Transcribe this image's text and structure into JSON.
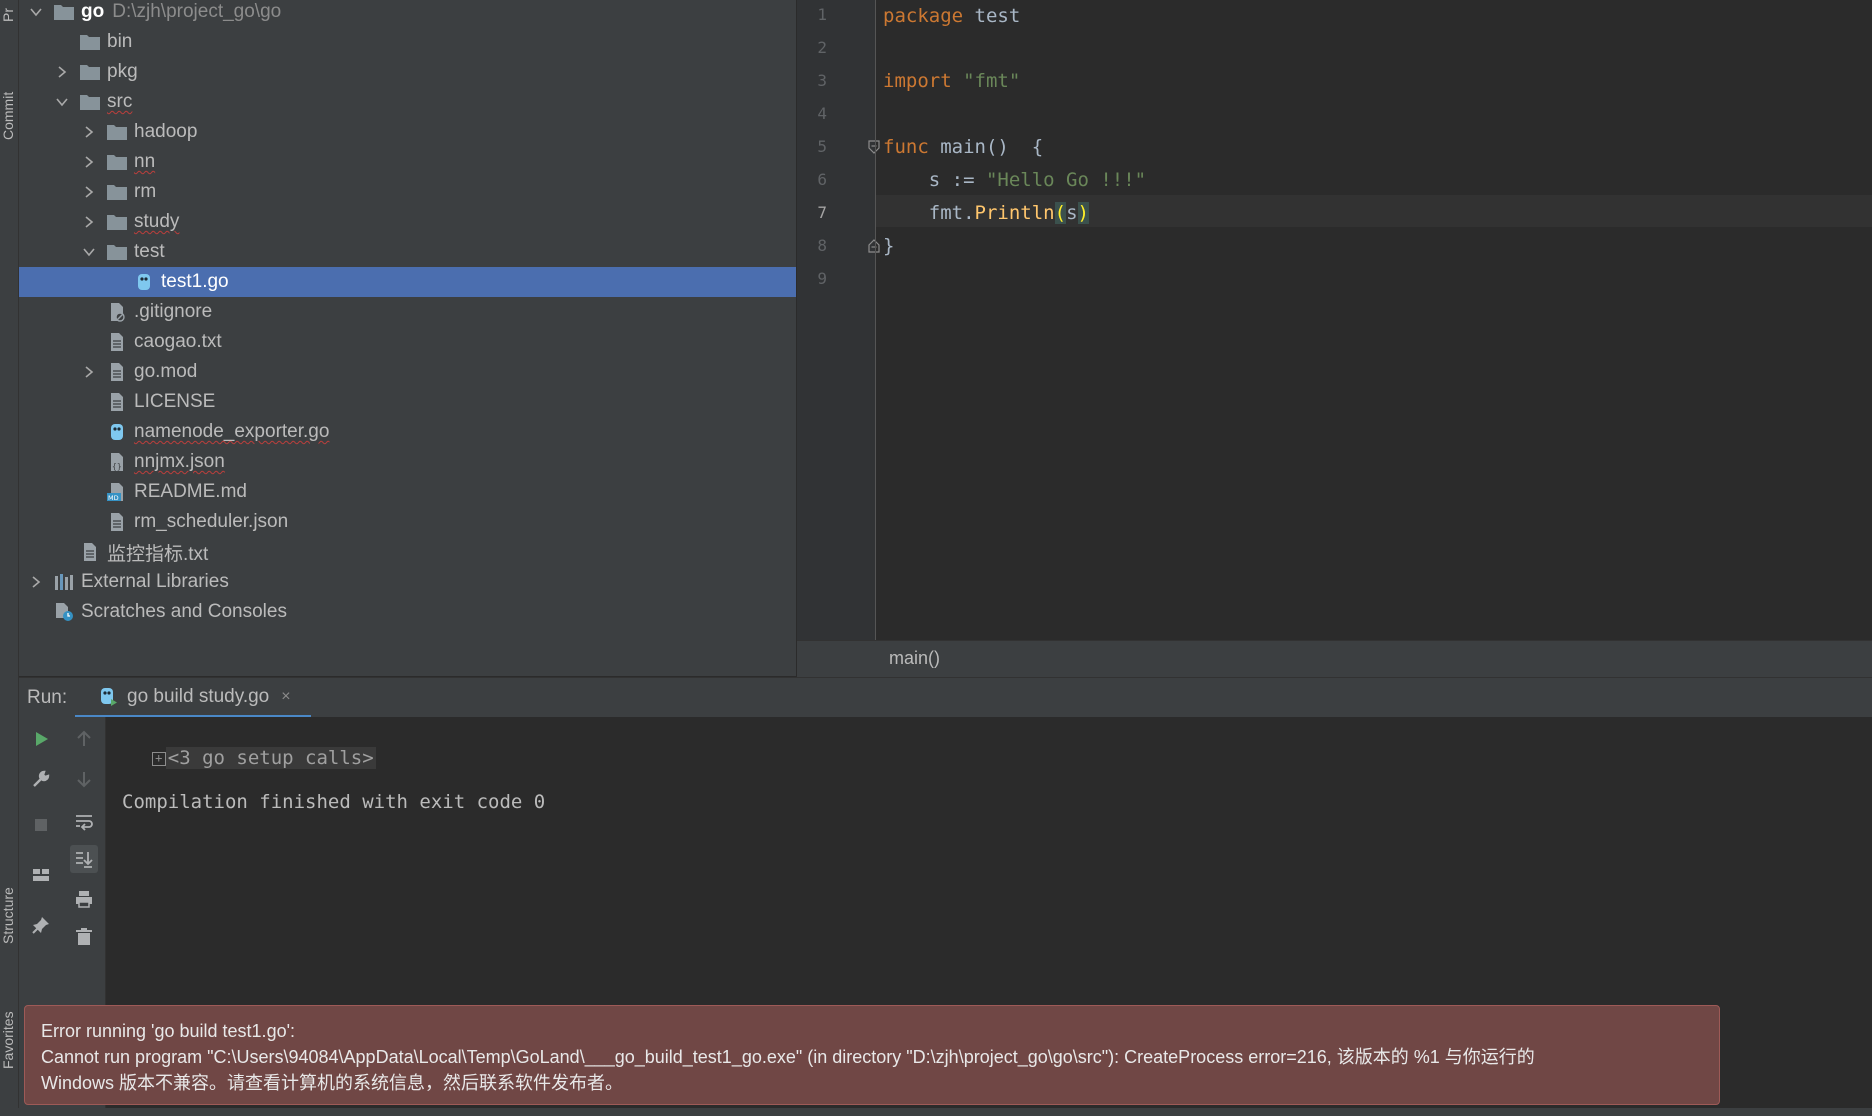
{
  "sidebar": {
    "top_label": "Pr",
    "commit_label": "Commit",
    "structure_label": "Structure",
    "favorites_label": "Favorites"
  },
  "project_tree": {
    "root_name": "go",
    "root_path": "D:\\zjh\\project_go\\go",
    "items": [
      {
        "label": "bin",
        "icon": "folder-icon"
      },
      {
        "label": "pkg",
        "icon": "folder-icon"
      },
      {
        "label": "src",
        "icon": "folder-icon"
      },
      {
        "label": "hadoop",
        "icon": "folder-icon"
      },
      {
        "label": "nn",
        "icon": "folder-icon"
      },
      {
        "label": "rm",
        "icon": "folder-icon"
      },
      {
        "label": "study",
        "icon": "folder-icon"
      },
      {
        "label": "test",
        "icon": "folder-icon"
      },
      {
        "label": "test1.go",
        "icon": "go-file-icon"
      },
      {
        "label": ".gitignore",
        "icon": "ignore-file-icon"
      },
      {
        "label": "caogao.txt",
        "icon": "text-file-icon"
      },
      {
        "label": "go.mod",
        "icon": "text-file-icon"
      },
      {
        "label": "LICENSE",
        "icon": "text-file-icon"
      },
      {
        "label": "namenode_exporter.go",
        "icon": "go-file-icon"
      },
      {
        "label": "nnjmx.json",
        "icon": "json-file-icon"
      },
      {
        "label": "README.md",
        "icon": "markdown-file-icon"
      },
      {
        "label": "rm_scheduler.json",
        "icon": "text-file-icon"
      },
      {
        "label": "监控指标.txt",
        "icon": "text-file-icon"
      },
      {
        "label": "External Libraries",
        "icon": "libraries-icon"
      },
      {
        "label": "Scratches and Consoles",
        "icon": "scratches-icon"
      }
    ]
  },
  "editor": {
    "line_numbers": [
      "1",
      "2",
      "3",
      "4",
      "5",
      "6",
      "7",
      "8",
      "9"
    ],
    "code": {
      "l1_kw": "package",
      "l1_rest": " test",
      "l3_kw": "import",
      "l3_sp": " ",
      "l3_str": "\"fmt\"",
      "l5_kw": "func",
      "l5_sp": " ",
      "l5_fn": "main",
      "l5_rest": "()  {",
      "l6_pre": "    s := ",
      "l6_str": "\"Hello Go !!!\"",
      "l7_pre": "    ",
      "l7_pkg": "fmt.",
      "l7_fn": "Println",
      "l7_open": "(",
      "l7_arg": "s",
      "l7_close": ")",
      "l8": "}"
    },
    "breadcrumb": "main()"
  },
  "run_panel": {
    "label": "Run:",
    "tab_label": "go build study.go",
    "tab_close": "×",
    "console_lines": {
      "folded": "<3 go setup calls>",
      "finished": "Compilation finished with exit code 0"
    }
  },
  "error_balloon": {
    "line1": "Error running 'go build test1.go':",
    "line2": "Cannot run program \"C:\\Users\\94084\\AppData\\Local\\Temp\\GoLand\\___go_build_test1_go.exe\" (in directory \"D:\\zjh\\project_go\\go\\src\"): CreateProcess error=216, 该版本的 %1 与你运行的",
    "line3": "Windows 版本不兼容。请查看计算机的系统信息，然后联系软件发布者。"
  },
  "colors": {
    "selection": "#4b6eaf",
    "keyword": "#cc7832",
    "string": "#6a8759",
    "function": "#ffc66d",
    "error_bg": "#704745"
  }
}
